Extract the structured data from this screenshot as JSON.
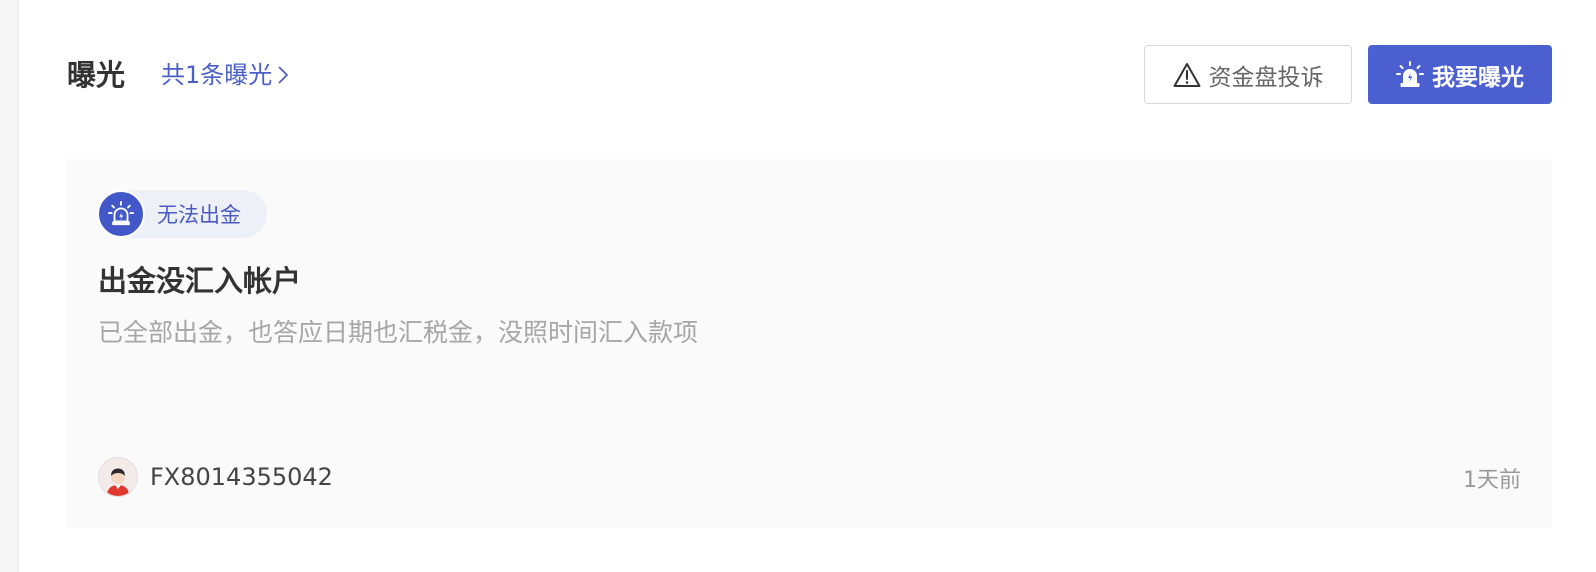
{
  "section": {
    "title": "曝光",
    "total_link": "共1条曝光"
  },
  "actions": {
    "complaint_label": "资金盘投诉",
    "expose_label": "我要曝光"
  },
  "post": {
    "tag": "无法出金",
    "title": "出金没汇入帐户",
    "description": "已全部出金，也答应日期也汇税金，没照时间汇入款项",
    "author": "FX8014355042",
    "time": "1天前"
  },
  "colors": {
    "accent": "#4b5fd0",
    "tag_bg": "#eef0f8",
    "card_bg": "#fafafa",
    "muted_text": "#a6a6a6"
  },
  "icons": {
    "complaint": "warning-triangle-icon",
    "expose": "alarm-siren-icon",
    "tag": "alarm-siren-icon",
    "link": "chevron-right-icon",
    "avatar": "user-avatar-icon"
  }
}
